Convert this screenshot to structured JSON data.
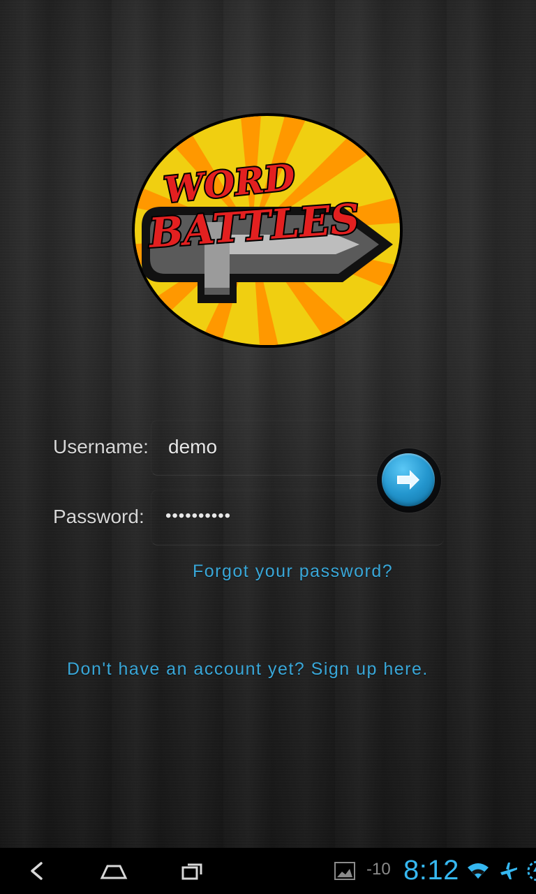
{
  "logo": {
    "line1": "WORD",
    "line2": "BATTLES"
  },
  "login": {
    "username_label": "Username:",
    "username_value": "demo",
    "password_label": "Password:",
    "password_value": "••••••••••",
    "forgot_text": "Forgot your password?",
    "signup_text": "Don't have an account yet? Sign up here."
  },
  "status_bar": {
    "temperature": "-10",
    "time": "8:12"
  },
  "icons": {
    "back": "back-icon",
    "home": "home-icon",
    "recent": "recent-apps-icon",
    "gallery": "gallery-icon",
    "wifi": "wifi-icon",
    "airplane": "airplane-icon",
    "battery": "battery-charging-icon",
    "go": "arrow-right-icon"
  },
  "colors": {
    "link": "#39a7d8",
    "time": "#36b7f0",
    "button": "#2497cf",
    "background": "#242424"
  }
}
